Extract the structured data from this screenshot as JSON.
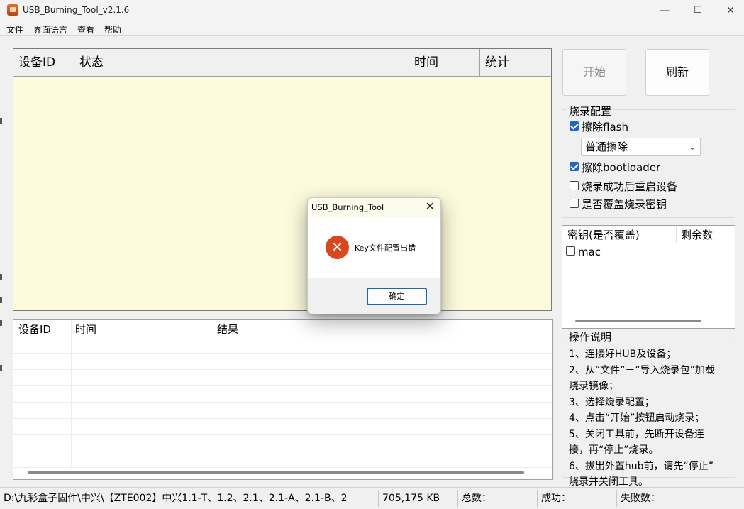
{
  "window": {
    "title": "USB_Burning_Tool_v2.1.6",
    "minimize": "—",
    "maximize": "☐",
    "close": "✕"
  },
  "menu": [
    "文件",
    "界面语言",
    "查看",
    "帮助"
  ],
  "device_table": {
    "columns": [
      "设备ID",
      "状态",
      "时间",
      "统计"
    ]
  },
  "result_table": {
    "columns": [
      "设备ID",
      "时间",
      "结果"
    ]
  },
  "buttons": {
    "start": "开始",
    "refresh": "刷新"
  },
  "burn_config": {
    "title": "烧录配置",
    "erase_flash": {
      "label": "擦除flash",
      "checked": true
    },
    "erase_mode": {
      "value": "普通擦除"
    },
    "erase_bootloader": {
      "label": "擦除bootloader",
      "checked": true
    },
    "reboot_after": {
      "label": "烧录成功后重启设备",
      "checked": false
    },
    "overwrite_key": {
      "label": "是否覆盖烧录密钥",
      "checked": false
    }
  },
  "key_table": {
    "columns": [
      "密钥(是否覆盖)",
      "剩余数"
    ],
    "rows": [
      {
        "label": "mac",
        "checked": false
      }
    ]
  },
  "instructions": {
    "title": "操作说明",
    "lines": [
      "1、连接好HUB及设备；",
      "2、从“文件”－“导入烧录包”加载",
      "烧录镜像；",
      "3、选择烧录配置；",
      "4、点击“开始”按钮启动烧录；",
      "5、关闭工具前，先断开设备连",
      "接，再“停止”烧录。",
      "6、拔出外置hub前，请先“停止”",
      "烧录并关闭工具。"
    ]
  },
  "status_bar": {
    "path": "D:\\九彩盒子固件\\中兴\\【ZTE002】中兴1.1-T、1.2、2.1、2.1-A、2.1-B、2",
    "size": "705,175 KB",
    "total": "总数：",
    "success": "成功：",
    "failed": "失败数："
  },
  "dialog": {
    "title": "USB_Burning_Tool",
    "close": "✕",
    "icon": "error-icon",
    "icon_glyph": "✕",
    "message": "Key文件配置出错",
    "ok": "确定"
  },
  "colors": {
    "device_table_bg": "#fdfbdc",
    "dialog_titlebar_bg": "#fbfcec",
    "error_icon": "#d9481e",
    "checkbox_accent": "#1f67c6",
    "default_button_border": "#1d63b8"
  }
}
